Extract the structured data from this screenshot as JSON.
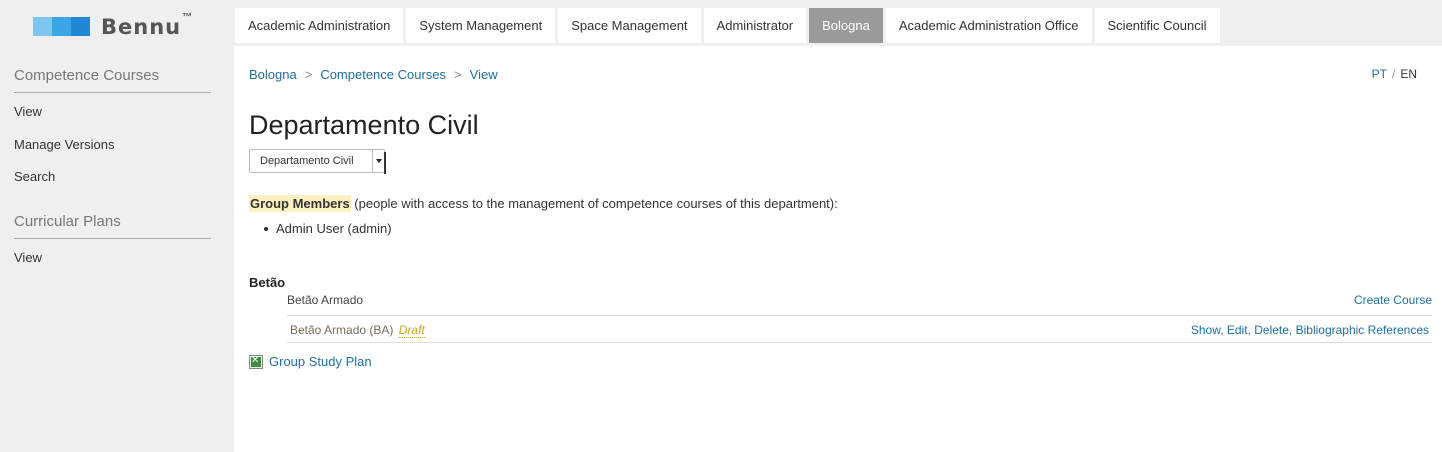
{
  "brand": {
    "name": "Bennu",
    "tm": "™",
    "colors": [
      "#7ec6f0",
      "#3aa6e6",
      "#1f87d6"
    ]
  },
  "sidebar": {
    "sections": [
      {
        "title": "Competence Courses",
        "items": [
          "View",
          "Manage Versions",
          "Search"
        ]
      },
      {
        "title": "Curricular Plans",
        "items": [
          "View"
        ]
      }
    ]
  },
  "topnav": {
    "tabs": [
      "Academic Administration",
      "System Management",
      "Space Management",
      "Administrator",
      "Bologna",
      "Academic Administration Office",
      "Scientific Council"
    ],
    "active": "Bologna"
  },
  "breadcrumb": {
    "items": [
      "Bologna",
      "Competence Courses",
      "View"
    ],
    "separator": ">"
  },
  "lang": {
    "pt": "PT",
    "sep": "/",
    "en": "EN"
  },
  "page": {
    "title": "Departamento Civil",
    "department_select": "Departamento Civil"
  },
  "group": {
    "label": "Group Members",
    "description": " (people with access to the management of competence courses of this department):",
    "members": [
      "Admin User (admin)"
    ]
  },
  "area": {
    "title": "Betão",
    "group_name": "Betão Armado",
    "create_label": "Create Course",
    "course": {
      "name": "Betão Armado (BA)",
      "state": "Draft",
      "actions": [
        "Show",
        "Edit",
        "Delete",
        "Bibliographic References"
      ]
    }
  },
  "study_plan": {
    "label": "Group Study Plan"
  }
}
